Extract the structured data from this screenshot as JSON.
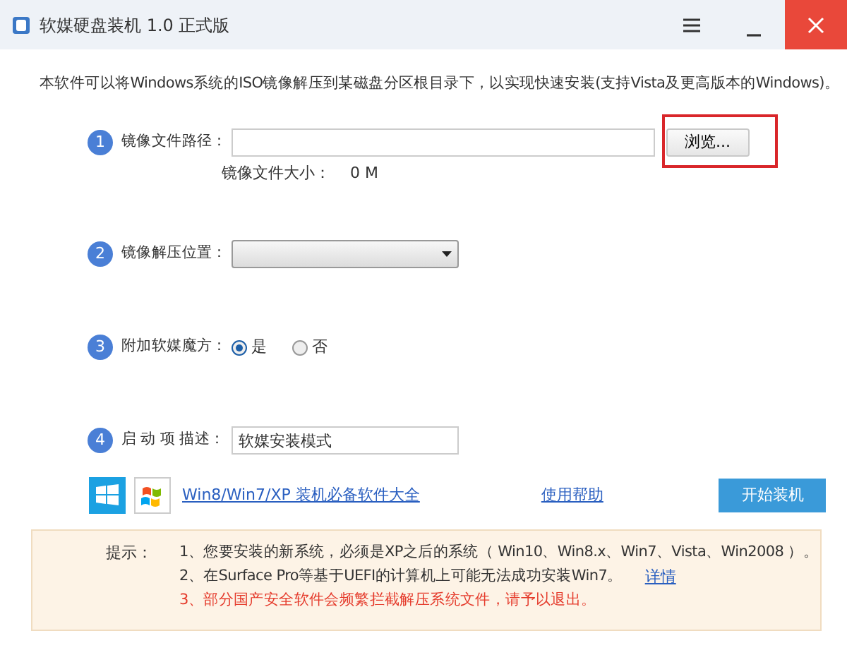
{
  "window": {
    "title": "软媒硬盘装机 1.0 正式版"
  },
  "intro": "本软件可以将Windows系统的ISO镜像解压到某磁盘分区根目录下，以实现快速安装(支持Vista及更高版本的Windows)。",
  "steps": [
    {
      "number": "1",
      "kind": "file",
      "label": "镜像文件路径：",
      "button": {
        "label": "浏览...",
        "highlighted": true
      },
      "size_label": "镜像文件大小：",
      "size_value": "0 M"
    },
    {
      "number": "2",
      "kind": "select",
      "label": "镜像解压位置："
    },
    {
      "number": "3",
      "kind": "radio",
      "label": "附加软媒魔方：",
      "options": [
        {
          "label": "是",
          "selected": true
        },
        {
          "label": "否",
          "selected": false
        }
      ]
    },
    {
      "number": "4",
      "kind": "text",
      "label": "启 动 项 描述：",
      "value": "软媒安装模式"
    }
  ],
  "footer": {
    "software_link": "Win8/Win7/XP 装机必备软件大全",
    "help_link": "使用帮助",
    "start_button": "开始装机"
  },
  "notice": {
    "label": "提示：",
    "items": [
      {
        "text": "1、您要安装的新系统，必须是XP之后的系统（ Win10、Win8.x、Win7、Vista、Win2008 ）。",
        "warning": false
      },
      {
        "text": "2、在Surface Pro等基于UEFI的计算机上可能无法成功安装Win7。",
        "link": "详情",
        "warning": false
      },
      {
        "text": "3、部分国产安全软件会频繁拦截解压系统文件，请予以退出。",
        "warning": true
      }
    ]
  }
}
